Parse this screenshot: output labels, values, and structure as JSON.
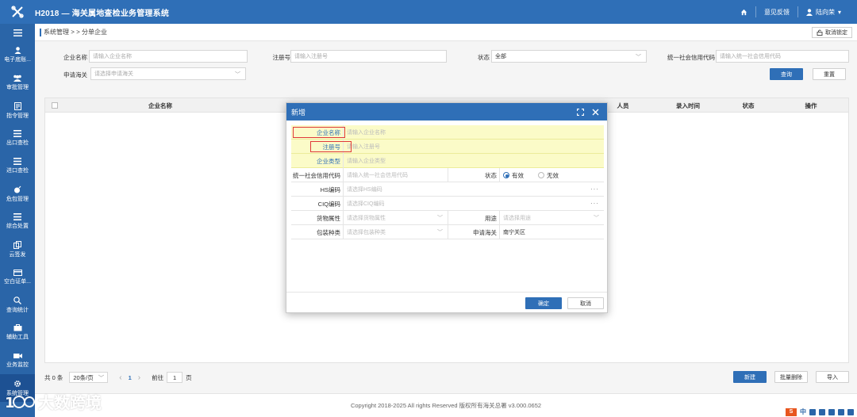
{
  "app": {
    "title": "H2018 — 海关属地查检业务管理系统"
  },
  "topbar": {
    "home_icon": "home-icon",
    "feedback": "意见反馈",
    "user": "陆向荣"
  },
  "sidebar": {
    "items": [
      {
        "label": "电子底账...",
        "icon": "person-icon"
      },
      {
        "label": "审批管理",
        "icon": "group-icon"
      },
      {
        "label": "指令管理",
        "icon": "document-icon"
      },
      {
        "label": "出口查检",
        "icon": "list-icon"
      },
      {
        "label": "进口查检",
        "icon": "list-icon"
      },
      {
        "label": "危包管理",
        "icon": "bomb-icon"
      },
      {
        "label": "综合处置",
        "icon": "list-icon"
      },
      {
        "label": "云签发",
        "icon": "copy-icon"
      },
      {
        "label": "空白证单...",
        "icon": "card-icon"
      },
      {
        "label": "查询统计",
        "icon": "search-icon"
      },
      {
        "label": "辅助工具",
        "icon": "briefcase-icon"
      },
      {
        "label": "业务监控",
        "icon": "camera-icon"
      },
      {
        "label": "系统管理",
        "icon": "gear-icon"
      }
    ]
  },
  "breadcrumb": "系统管理 > > 分单企业",
  "unlock_button": "取消锁定",
  "filters": {
    "company_name": {
      "label": "企业名称",
      "placeholder": "请输入企业名称"
    },
    "reg_no": {
      "label": "注册号",
      "placeholder": "请输入注册号"
    },
    "status": {
      "label": "状态",
      "value": "全部"
    },
    "credit_code": {
      "label": "统一社会信用代码",
      "placeholder": "请输入统一社会信用代码"
    },
    "customs": {
      "label": "申请海关",
      "placeholder": "请选择申请海关"
    },
    "query_button": "查询",
    "reset_button": "重置"
  },
  "table": {
    "columns": [
      "企业名称",
      "人员",
      "录入时间",
      "状态",
      "操作"
    ]
  },
  "pager": {
    "total": "共 0 条",
    "page_size": "20条/页",
    "prev": "‹",
    "current": "1",
    "next": "›",
    "goto_label": "前往",
    "goto_value": "1",
    "page_unit": "页",
    "new_button": "新建",
    "batch_delete_button": "批量删除",
    "import_button": "导入"
  },
  "footer": {
    "copyright": "Copyright 2018-2025 All rights Reserved 版权所有海关总署 v3.000.0652"
  },
  "watermark": "大数跨境",
  "modal": {
    "title": "新增",
    "fields": {
      "company_name": {
        "label": "企业名称",
        "placeholder": "请输入企业名称"
      },
      "reg_no": {
        "label": "注册号",
        "placeholder": "请输入注册号"
      },
      "company_type": {
        "label": "企业类型",
        "placeholder": "请输入企业类型"
      },
      "credit_code": {
        "label": "统一社会信用代码",
        "placeholder": "请输入统一社会信用代码"
      },
      "status": {
        "label": "状态",
        "opt_valid": "有效",
        "opt_invalid": "无效"
      },
      "hs_code": {
        "label": "HS编码",
        "placeholder": "请选择HS编码"
      },
      "ciq_code": {
        "label": "CIQ编码",
        "placeholder": "请选择CIQ编码"
      },
      "goods_attr": {
        "label": "货物属性",
        "placeholder": "请选择货物属性"
      },
      "usage": {
        "label": "用途",
        "placeholder": "请选择用途"
      },
      "package_type": {
        "label": "包装种类",
        "placeholder": "请选择包装种类"
      },
      "apply_customs": {
        "label": "申请海关",
        "value": "南宁关区"
      }
    },
    "confirm_button": "确定",
    "cancel_button": "取消"
  },
  "tray": {
    "cn": "中"
  },
  "colors": {
    "primary": "#2f6fb7",
    "sidebar": "#2a65a8",
    "highlight": "#fbfbc8",
    "required_box": "#e03a3a"
  }
}
